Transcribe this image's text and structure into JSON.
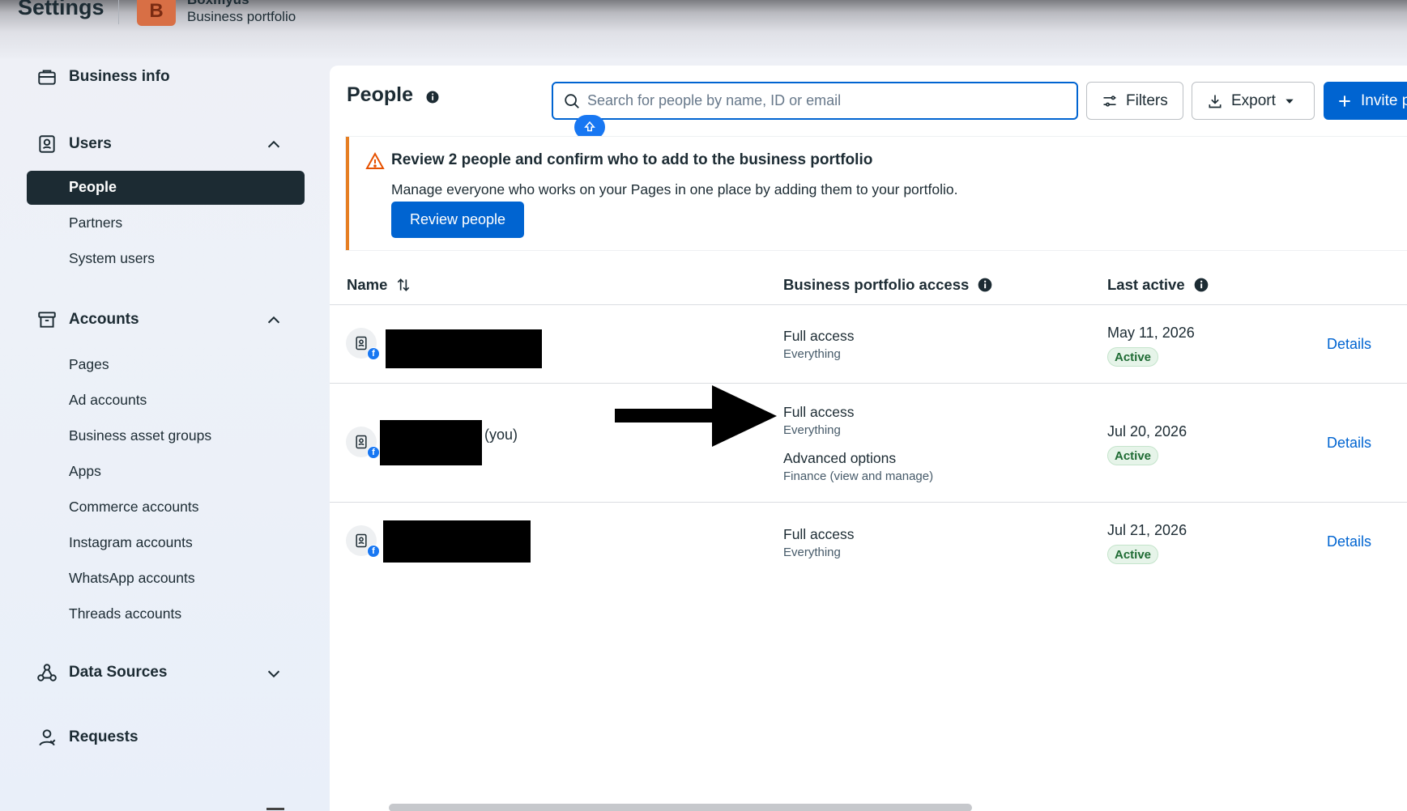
{
  "header": {
    "settings_title": "Settings",
    "business_avatar_letter": "B",
    "business_name": "Boxmyus",
    "business_subtitle": "Business portfolio"
  },
  "sidebar": {
    "business_info": "Business info",
    "users": {
      "label": "Users",
      "items": [
        "People",
        "Partners",
        "System users"
      ],
      "active": "People"
    },
    "accounts": {
      "label": "Accounts",
      "items": [
        "Pages",
        "Ad accounts",
        "Business asset groups",
        "Apps",
        "Commerce accounts",
        "Instagram accounts",
        "WhatsApp accounts",
        "Threads accounts"
      ]
    },
    "data_sources": "Data Sources",
    "requests": "Requests"
  },
  "main": {
    "title": "People",
    "search_placeholder": "Search for people by name, ID or email",
    "filters_label": "Filters",
    "export_label": "Export",
    "invite_label": "Invite p",
    "alert": {
      "title": "Review 2 people and confirm who to add to the business portfolio",
      "body": "Manage everyone who works on your Pages in one place by adding them to your portfolio.",
      "button": "Review people"
    },
    "table": {
      "col_name": "Name",
      "col_access": "Business portfolio access",
      "col_last_active": "Last active",
      "rows": [
        {
          "name_suffix": "",
          "access": "Full access",
          "access_sub": "Everything",
          "date": "May 11, 2026",
          "status": "Active",
          "action": "Details"
        },
        {
          "name_suffix": "(you)",
          "access": "Full access",
          "access_sub": "Everything",
          "advanced": "Advanced options",
          "advanced_sub": "Finance (view and manage)",
          "date": "Jul 20, 2026",
          "status": "Active",
          "action": "Details"
        },
        {
          "name_suffix": "",
          "access": "Full access",
          "access_sub": "Everything",
          "date": "Jul 21, 2026",
          "status": "Active",
          "action": "Details"
        }
      ]
    }
  },
  "colors": {
    "primary": "#0064d1",
    "dark_nav": "#1c2b33",
    "alert_accent": "#e67e22",
    "active_badge_bg": "#e6f4e9"
  }
}
